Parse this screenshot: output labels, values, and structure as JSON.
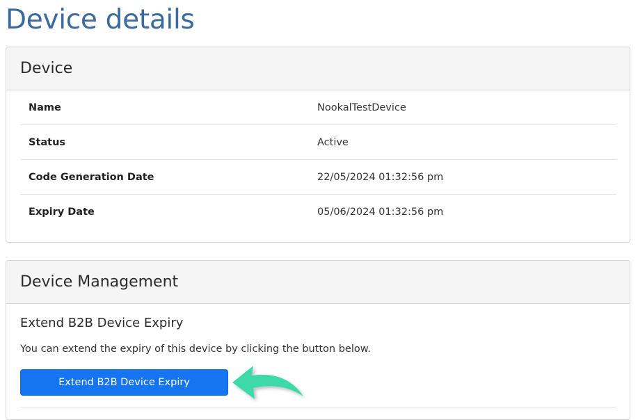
{
  "page": {
    "title": "Device details"
  },
  "device_card": {
    "header": "Device",
    "rows": [
      {
        "label": "Name",
        "value": "NookalTestDevice"
      },
      {
        "label": "Status",
        "value": "Active"
      },
      {
        "label": "Code Generation Date",
        "value": "22/05/2024 01:32:56 pm"
      },
      {
        "label": "Expiry Date",
        "value": "05/06/2024 01:32:56 pm"
      }
    ]
  },
  "management_card": {
    "header": "Device Management",
    "section_heading": "Extend B2B Device Expiry",
    "description": "You can extend the expiry of this device by clicking the button below.",
    "button_label": "Extend B2B Device Expiry"
  },
  "colors": {
    "title": "#3a6aa0",
    "button": "#1574f0",
    "arrow": "#3ed9a6"
  },
  "icons": {
    "annotation_arrow": "curved-arrow-left-icon"
  }
}
